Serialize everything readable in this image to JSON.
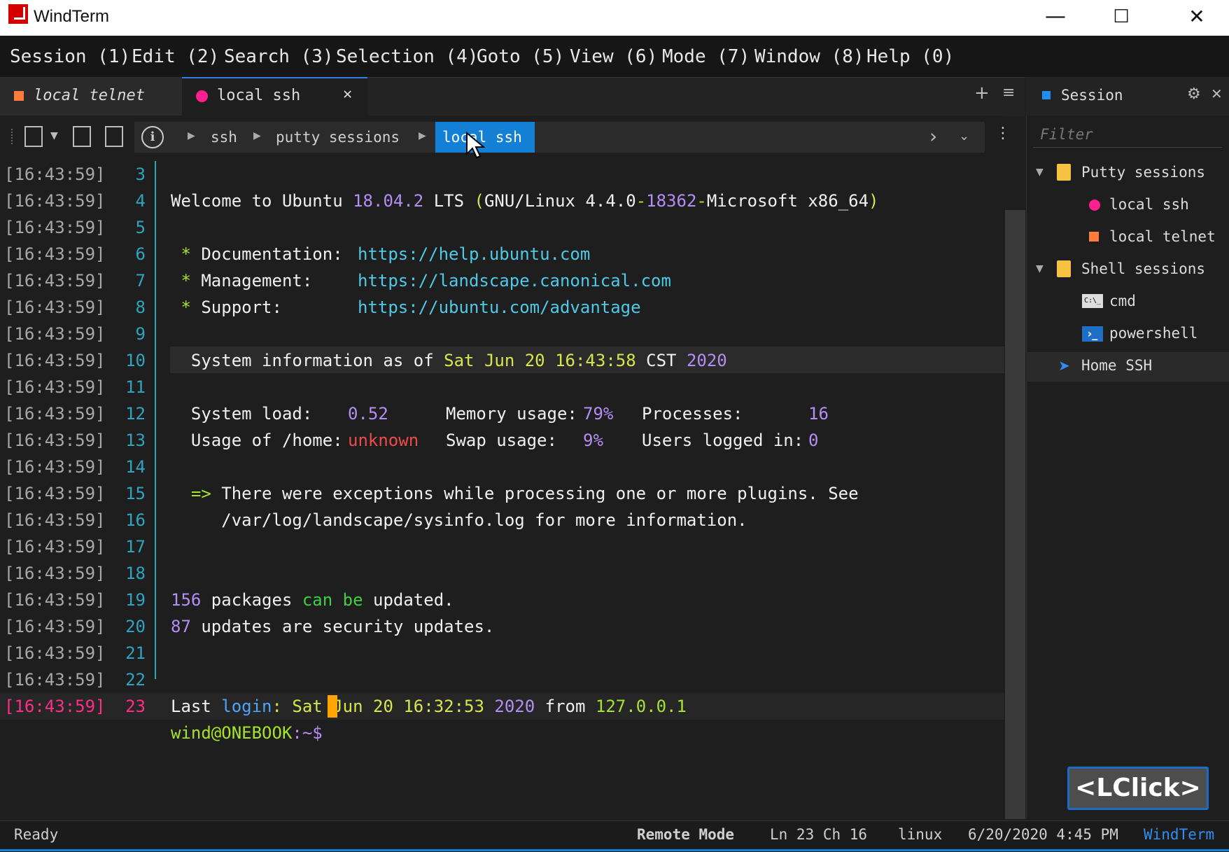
{
  "window": {
    "title": "WindTerm",
    "minimize": "—",
    "maximize": "☐",
    "close": "✕"
  },
  "menu": [
    "Session (1)",
    "Edit (2)",
    "Search (3)",
    "Selection (4)",
    "Goto (5)",
    "View (6)",
    "Mode (7)",
    "Window (8)",
    "Help (0)"
  ],
  "tabs": [
    {
      "label": "local telnet",
      "color": "#ff7a3d"
    },
    {
      "label": "local ssh",
      "color": "#ff1f8f",
      "close": "✕"
    }
  ],
  "breadcrumb": [
    "ssh",
    "putty sessions",
    "local ssh"
  ],
  "terminal": {
    "timestamp": "[16:43:59]",
    "line_numbers": [
      "3",
      "4",
      "5",
      "6",
      "7",
      "8",
      "9",
      "10",
      "11",
      "12",
      "13",
      "14",
      "15",
      "16",
      "17",
      "18",
      "19",
      "20",
      "21",
      "22",
      "23"
    ],
    "welcome": {
      "a": "Welcome to Ubuntu ",
      "ver": "18.04.2",
      "b": " LTS ",
      "p1": "(",
      "c": "GNU/Linux 4.4.0",
      "d": "-",
      "e": "18362",
      "f": "-",
      "g": "Microsoft x86_64",
      "p2": ")"
    },
    "doc": {
      "star": " * ",
      "label": "Documentation:",
      "url": "https://help.ubuntu.com"
    },
    "mgmt": {
      "star": " * ",
      "label": "Management:",
      "url": "https://landscape.canonical.com"
    },
    "support": {
      "star": " * ",
      "label": "Support:",
      "url": "https://ubuntu.com/advantage"
    },
    "sysinfo": {
      "a": "  System information as of ",
      "date": "Sat Jun 20 16:43:58",
      "tz": " CST ",
      "year": "2020"
    },
    "load": {
      "a": "  System load:",
      "v": "0.52",
      "b": "Memory usage:",
      "mem": "79%",
      "c": "Processes:",
      "proc": "16"
    },
    "usage": {
      "a": "  Usage of /home:",
      "v": "unknown",
      "b": "Swap usage:",
      "swap": "9%",
      "c": "Users logged in:",
      "users": "0"
    },
    "exc1": {
      "arrow": "  =>",
      "text": " There were exceptions while processing one or more plugins. See"
    },
    "exc2": "     /var/log/landscape/sysinfo.log for more information.",
    "pkgs": {
      "n": "156",
      "a": " packages ",
      "b": "can be",
      "c": " updated."
    },
    "sec": {
      "n": "87",
      "a": " updates are security updates."
    },
    "last": {
      "a": "Last ",
      "b": "login",
      "c": ": ",
      "d": "Sat Jun 20 16:32:53",
      "e": " 2020",
      "f": " from ",
      "ip": "127.0.0.1"
    },
    "prompt": {
      "user": "wind@ONEBOOK",
      "path": ":~$"
    }
  },
  "side": {
    "title": "Session",
    "filter_placeholder": "Filter",
    "groups": [
      {
        "label": "Putty sessions",
        "items": [
          "local ssh",
          "local telnet"
        ]
      },
      {
        "label": "Shell sessions",
        "items": [
          "cmd",
          "powershell"
        ]
      }
    ],
    "home": "Home SSH",
    "cmd_icon_text": "C:\\_"
  },
  "overlay": "<LClick>",
  "status": {
    "ready": "Ready",
    "mode": "Remote Mode",
    "pos": "Ln 23 Ch 16",
    "os": "linux",
    "datetime": "6/20/2020 4:45 PM",
    "app": "WindTerm"
  }
}
